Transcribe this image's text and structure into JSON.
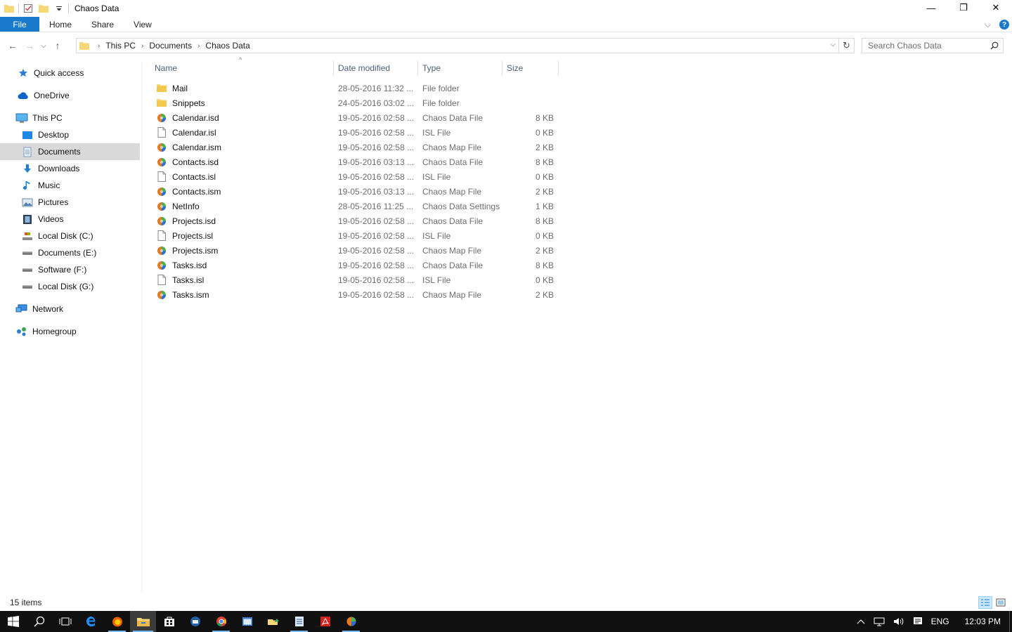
{
  "window": {
    "title": "Chaos Data",
    "minimize": "—",
    "maximize": "❐",
    "close": "✕"
  },
  "ribbon": {
    "tabs": [
      "File",
      "Home",
      "Share",
      "View"
    ],
    "expand": "⌵",
    "help": "?"
  },
  "nav": {
    "back": "←",
    "forward": "→",
    "recent": "⌵",
    "up": "↑",
    "breadcrumb": [
      "This PC",
      "Documents",
      "Chaos Data"
    ],
    "separator": "›",
    "refresh": "↻",
    "search_placeholder": "Search Chaos Data"
  },
  "sidebar": {
    "items": [
      {
        "label": "Quick access",
        "icon": "star-icon"
      },
      {
        "label": "OneDrive",
        "icon": "cloud-icon"
      },
      {
        "label": "This PC",
        "icon": "computer-icon"
      },
      {
        "label": "Desktop",
        "icon": "desktop-icon"
      },
      {
        "label": "Documents",
        "icon": "documents-icon",
        "selected": true
      },
      {
        "label": "Downloads",
        "icon": "download-icon"
      },
      {
        "label": "Music",
        "icon": "music-icon"
      },
      {
        "label": "Pictures",
        "icon": "pictures-icon"
      },
      {
        "label": "Videos",
        "icon": "videos-icon"
      },
      {
        "label": "Local Disk (C:)",
        "icon": "drive-c-icon"
      },
      {
        "label": "Documents (E:)",
        "icon": "drive-icon"
      },
      {
        "label": "Software (F:)",
        "icon": "drive-icon"
      },
      {
        "label": "Local Disk (G:)",
        "icon": "drive-icon"
      },
      {
        "label": "Network",
        "icon": "network-icon"
      },
      {
        "label": "Homegroup",
        "icon": "homegroup-icon"
      }
    ]
  },
  "columns": {
    "name": "Name",
    "date": "Date modified",
    "type": "Type",
    "size": "Size",
    "sort_indicator": "^"
  },
  "files": [
    {
      "name": "Mail",
      "date": "28-05-2016 11:32 ...",
      "type": "File folder",
      "size": "",
      "icon": "folder"
    },
    {
      "name": "Snippets",
      "date": "24-05-2016 03:02 ...",
      "type": "File folder",
      "size": "",
      "icon": "folder"
    },
    {
      "name": "Calendar.isd",
      "date": "19-05-2016 02:58 ...",
      "type": "Chaos Data File",
      "size": "8 KB",
      "icon": "chaos"
    },
    {
      "name": "Calendar.isl",
      "date": "19-05-2016 02:58 ...",
      "type": "ISL File",
      "size": "0 KB",
      "icon": "blank"
    },
    {
      "name": "Calendar.ism",
      "date": "19-05-2016 02:58 ...",
      "type": "Chaos Map File",
      "size": "2 KB",
      "icon": "chaos"
    },
    {
      "name": "Contacts.isd",
      "date": "19-05-2016 03:13 ...",
      "type": "Chaos Data File",
      "size": "8 KB",
      "icon": "chaos"
    },
    {
      "name": "Contacts.isl",
      "date": "19-05-2016 02:58 ...",
      "type": "ISL File",
      "size": "0 KB",
      "icon": "blank"
    },
    {
      "name": "Contacts.ism",
      "date": "19-05-2016 03:13 ...",
      "type": "Chaos Map File",
      "size": "2 KB",
      "icon": "chaos"
    },
    {
      "name": "NetInfo",
      "date": "28-05-2016 11:25 ...",
      "type": "Chaos Data Settings",
      "size": "1 KB",
      "icon": "chaos"
    },
    {
      "name": "Projects.isd",
      "date": "19-05-2016 02:58 ...",
      "type": "Chaos Data File",
      "size": "8 KB",
      "icon": "chaos"
    },
    {
      "name": "Projects.isl",
      "date": "19-05-2016 02:58 ...",
      "type": "ISL File",
      "size": "0 KB",
      "icon": "blank"
    },
    {
      "name": "Projects.ism",
      "date": "19-05-2016 02:58 ...",
      "type": "Chaos Map File",
      "size": "2 KB",
      "icon": "chaos"
    },
    {
      "name": "Tasks.isd",
      "date": "19-05-2016 02:58 ...",
      "type": "Chaos Data File",
      "size": "8 KB",
      "icon": "chaos"
    },
    {
      "name": "Tasks.isl",
      "date": "19-05-2016 02:58 ...",
      "type": "ISL File",
      "size": "0 KB",
      "icon": "blank"
    },
    {
      "name": "Tasks.ism",
      "date": "19-05-2016 02:58 ...",
      "type": "Chaos Map File",
      "size": "2 KB",
      "icon": "chaos"
    }
  ],
  "status": {
    "item_count": "15 items"
  },
  "taskbar": {
    "apps": [
      "start-icon",
      "search-icon",
      "task-view-icon",
      "edge-icon",
      "firefox-icon",
      "file-explorer-icon",
      "store-icon",
      "thunderbird-icon",
      "chrome-icon",
      "window-app-icon",
      "sync-icon",
      "notepad-icon",
      "acrobat-icon",
      "chaos-icon"
    ],
    "language": "ENG",
    "time": "12:03 PM"
  },
  "colors": {
    "accent": "#1979ca",
    "folder": "#f8d775",
    "selection": "#d9d9d9",
    "taskbar": "#101010"
  }
}
